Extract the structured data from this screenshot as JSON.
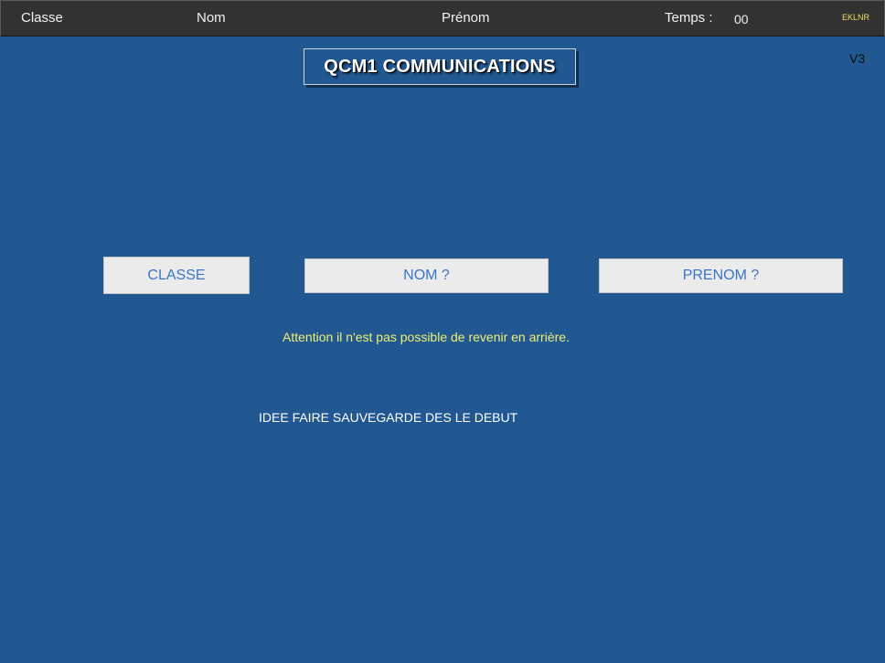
{
  "header": {
    "classe_label": "Classe",
    "nom_label": "Nom",
    "prenom_label": "Prénom",
    "temps_label": "Temps :",
    "temps_value": "00",
    "code": "EKLNR"
  },
  "title": "QCM1 COMMUNICATIONS",
  "version": "V3",
  "buttons": {
    "classe": "CLASSE",
    "nom": "NOM ?",
    "prenom": "PRENOM ?"
  },
  "warning": "Attention il n'est pas possible de revenir en arrière.",
  "note": "IDEE FAIRE SAUVEGARDE DES LE DEBUT",
  "colors": {
    "background": "#215891",
    "topbar": "#323232",
    "button_bg": "#ebebeb",
    "button_text": "#3b74c6",
    "warning_text": "#f0ef72"
  }
}
